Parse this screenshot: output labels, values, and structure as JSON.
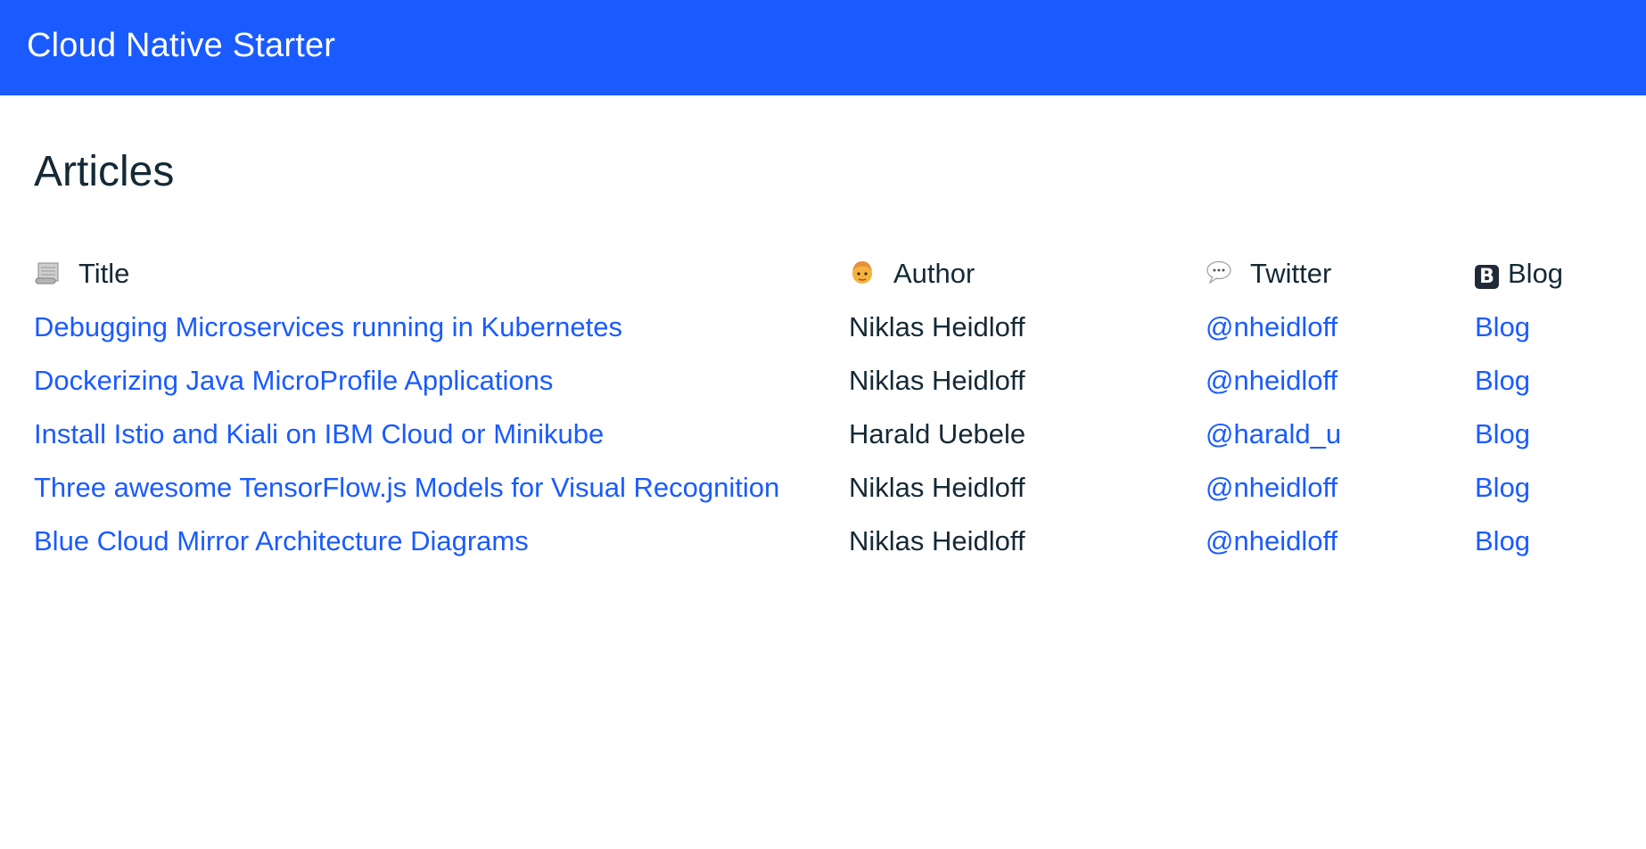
{
  "header": {
    "title": "Cloud Native Starter"
  },
  "main": {
    "page_title": "Articles",
    "table": {
      "columns": [
        {
          "label": "Title",
          "icon": "scroll-icon"
        },
        {
          "label": "Author",
          "icon": "person-icon"
        },
        {
          "label": "Twitter",
          "icon": "speech-balloon-icon"
        },
        {
          "label": "Blog",
          "icon": "b-letter-icon"
        }
      ],
      "rows": [
        {
          "title": "Debugging Microservices running in Kubernetes",
          "author": "Niklas Heidloff",
          "twitter": "@nheidloff",
          "blog": "Blog"
        },
        {
          "title": "Dockerizing Java MicroProfile Applications",
          "author": "Niklas Heidloff",
          "twitter": "@nheidloff",
          "blog": "Blog"
        },
        {
          "title": "Install Istio and Kiali on IBM Cloud or Minikube",
          "author": "Harald Uebele",
          "twitter": "@harald_u",
          "blog": "Blog"
        },
        {
          "title": "Three awesome TensorFlow.js Models for Visual Recognition",
          "author": "Niklas Heidloff",
          "twitter": "@nheidloff",
          "blog": "Blog"
        },
        {
          "title": "Blue Cloud Mirror Architecture Diagrams",
          "author": "Niklas Heidloff",
          "twitter": "@nheidloff",
          "blog": "Blog"
        }
      ]
    }
  },
  "colors": {
    "header_bg": "#1a5bff",
    "link": "#1a5bff",
    "text": "#152935"
  }
}
